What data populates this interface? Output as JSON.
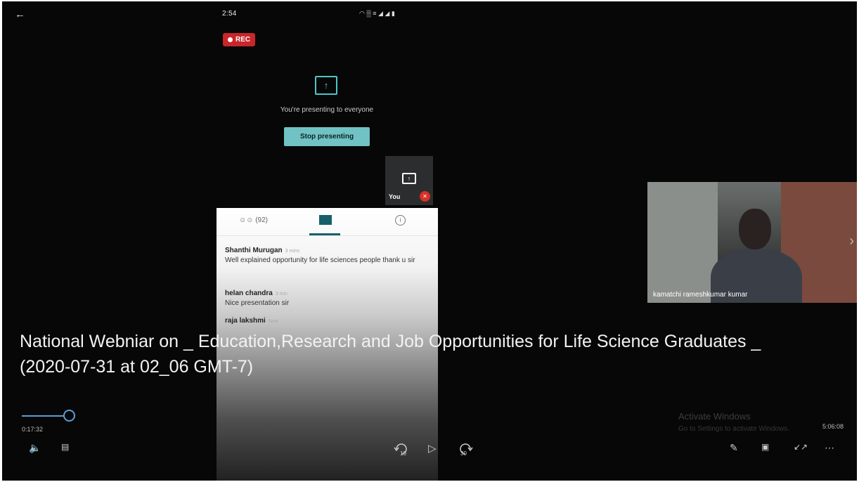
{
  "status_bar": {
    "time": "2:54",
    "icons_text": "◠ ▒ ≡ ◢ ◢ ▮"
  },
  "meeting": {
    "rec_label": "REC",
    "presenting_text": "You're presenting to everyone",
    "stop_presenting_label": "Stop presenting",
    "self_tile_label": "You",
    "remote_participant_name": "kamatchi rameshkumar kumar"
  },
  "chat": {
    "people_count": "(92)",
    "messages": [
      {
        "author": "Shanthi Murugan",
        "time": "3 mins",
        "text": "Well explained opportunity for life sciences people thank u sir"
      },
      {
        "author": "helan chandra",
        "time": "3 min",
        "text": "Nice presentation sir"
      },
      {
        "author": "raja lakshmi",
        "time": "Now",
        "text": ""
      }
    ]
  },
  "video": {
    "title": "National Webniar on _ Education,Research and Job Opportunities for Life Science Graduates _ (2020-07-31 at 02_06 GMT-7)",
    "elapsed": "0:17:32",
    "total": "5:06:08",
    "progress_fraction": 0.057,
    "skip_back_seconds": "10",
    "skip_forward_seconds": "30"
  },
  "watermark": {
    "line1": "Activate Windows",
    "line2": "Go to Settings to activate Windows."
  },
  "colors": {
    "accent": "#5c9dd6",
    "rec": "#c8262b",
    "stop_button": "#70c2c4",
    "chat_accent": "#17606a"
  }
}
